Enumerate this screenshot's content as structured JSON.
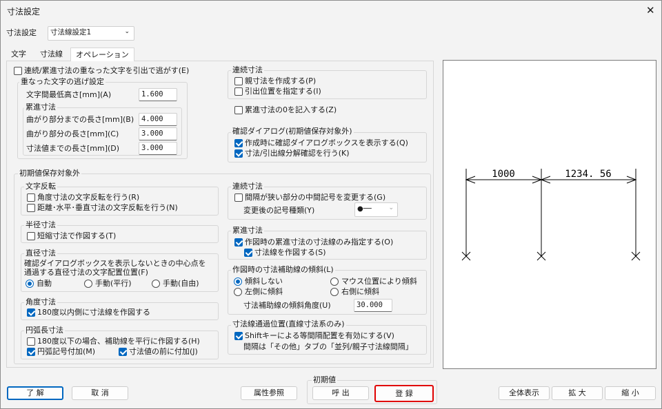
{
  "window": {
    "title": "寸法設定",
    "close": "✕"
  },
  "preset": {
    "label": "寸法設定",
    "value": "寸法線設定1"
  },
  "tabs": [
    "文字",
    "寸法線",
    "オペレーション"
  ],
  "escape": {
    "main_label": "連続/累進寸法の重なった文字を引出で逃がす(E)",
    "main_checked": false,
    "group_title": "重なった文字の逃げ設定",
    "min_height_label": "文字間最低高さ[mm](A)",
    "min_height": "1.600",
    "cumulative_title": "累進寸法",
    "bend_len_label": "曲がり部分までの長さ[mm](B)",
    "bend_len": "4.000",
    "bend_part_label": "曲がり部分の長さ[mm](C)",
    "bend_part": "3.000",
    "to_value_label": "寸法値までの長さ[mm](D)",
    "to_value": "3.000"
  },
  "continuous_top": {
    "title": "連続寸法",
    "parent": "親寸法を作成する(P)",
    "leader_pos": "引出位置を指定する(I)"
  },
  "cumulative_zero": "累進寸法の0を記入する(Z)",
  "confirm": {
    "title": "確認ダイアログ(初期値保存対象外)",
    "show_dialog": "作成時に確認ダイアログボックスを表示する(Q)",
    "decompose": "寸法/引出線分解確認を行う(K)"
  },
  "initial": {
    "title": "初期値保存対象外",
    "text_flip": {
      "title": "文字反転",
      "angle": "角度寸法の文字反転を行う(R)",
      "distance": "距離･水平･垂直寸法の文字反転を行う(N)"
    },
    "radius": {
      "title": "半径寸法",
      "short": "短縮寸法で作図する(T)"
    },
    "diameter": {
      "title": "直径寸法",
      "desc1": "確認ダイアログボックスを表示しないときの中心点を",
      "desc2": "通過する直径寸法の文字配置位置(F)",
      "opts": [
        "自動",
        "手動(平行)",
        "手動(自由)"
      ]
    },
    "angle": {
      "title": "角度寸法",
      "inner": "180度以内側に寸法線を作図する"
    },
    "arc": {
      "title": "円弧長寸法",
      "below180": "180度以下の場合、補助線を平行に作図する(H)",
      "symbol": "円弧記号付加(M)",
      "before_value": "寸法値の前に付加(J)"
    },
    "continuous": {
      "title": "連続寸法",
      "change": "間隔が狭い部分の中間記号を変更する(G)",
      "type_label": "変更後の記号種類(Y)",
      "type_symbol": "●──"
    },
    "cumulative": {
      "title": "累進寸法",
      "dim_only": "作図時の累進寸法の寸法線のみ指定する(O)",
      "create": "寸法線を作図する(S)"
    },
    "ext_tilt": {
      "title": "作図時の寸法補助線の傾斜(L)",
      "opts": [
        "傾斜しない",
        "マウス位置により傾斜",
        "左側に傾斜",
        "右側に傾斜"
      ],
      "angle_label": "寸法補助線の傾斜角度(U)",
      "angle": "30.000"
    },
    "pass_pos": {
      "title": "寸法線通過位置(直線寸法系のみ)",
      "shift": "Shiftキーによる等間隔配置を有効にする(V)",
      "note": "間隔は「その他」タブの「並列/親子寸法線間隔」"
    }
  },
  "preview": {
    "dim1": "1000",
    "dim2": "1234. 56"
  },
  "buttons": {
    "ok": "了 解",
    "cancel": "取 消",
    "attr": "属性参照",
    "init_title": "初期値",
    "call": "呼 出",
    "register": "登 録",
    "fit": "全体表示",
    "zoom_in": "拡 大",
    "zoom_out": "縮 小"
  },
  "colors": {
    "accent": "#0067c0",
    "highlight": "#e00000"
  }
}
